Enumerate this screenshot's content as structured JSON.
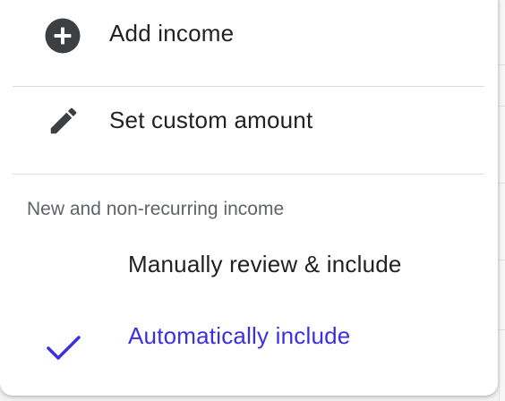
{
  "menu": {
    "items": [
      {
        "label": "Add income",
        "icon": "add-circle-icon"
      },
      {
        "label": "Set custom amount",
        "icon": "pencil-icon"
      }
    ],
    "section": {
      "header": "New and non-recurring income",
      "options": [
        {
          "label": "Manually review & include",
          "selected": false
        },
        {
          "label": "Automatically include",
          "selected": true,
          "icon": "checkmark-icon"
        }
      ]
    }
  },
  "colors": {
    "accent": "#3b2fe0",
    "text": "#222222",
    "muted": "#5f6368",
    "icon": "#3c4043",
    "divider": "#dcdcdc"
  }
}
